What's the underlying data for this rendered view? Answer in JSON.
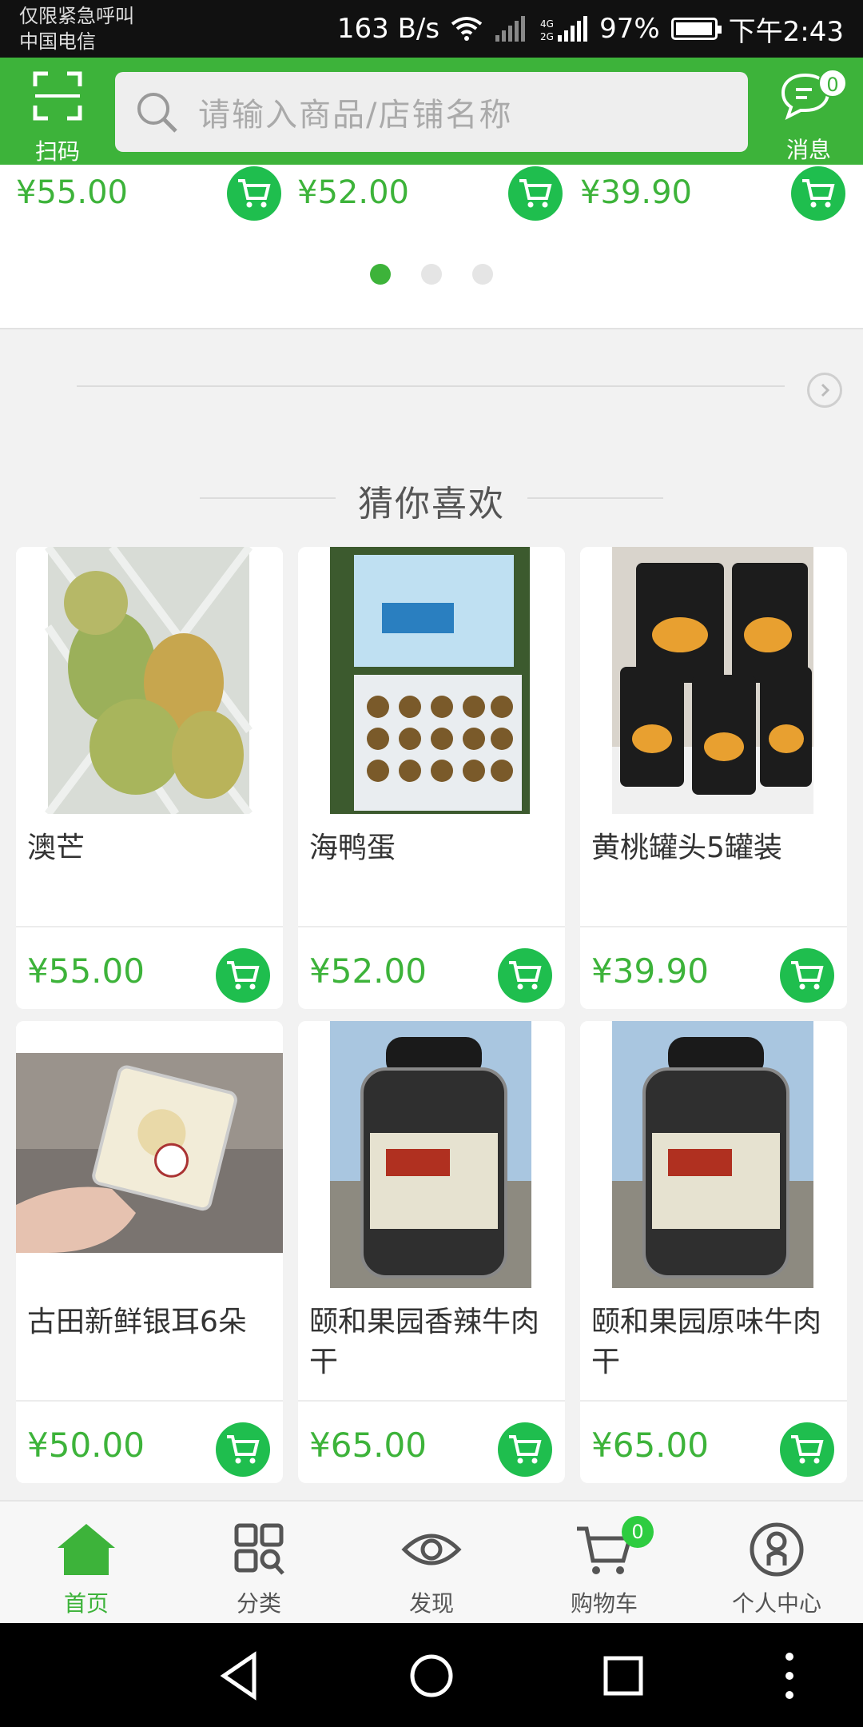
{
  "status_bar": {
    "carrier_line1": "仅限紧急呼叫",
    "carrier_line2": "中国电信",
    "net_speed": "163 B/s",
    "battery": "97%",
    "time": "下午2:43"
  },
  "header": {
    "scan_label": "扫码",
    "search_placeholder": "请输入商品/店铺名称",
    "message_label": "消息",
    "message_count": "0"
  },
  "carousel": {
    "prices": [
      "¥55.00",
      "¥52.00",
      "¥39.90"
    ],
    "page_count": 3,
    "active_page": 1
  },
  "section_title": "猜你喜欢",
  "products": [
    {
      "name": "澳芒",
      "price": "¥55.00"
    },
    {
      "name": "海鸭蛋",
      "price": "¥52.00"
    },
    {
      "name": "黄桃罐头5罐装",
      "price": "¥39.90"
    },
    {
      "name": "古田新鲜银耳6朵",
      "price": "¥50.00"
    },
    {
      "name": "颐和果园香辣牛肉干",
      "price": "¥65.00"
    },
    {
      "name": "颐和果园原味牛肉干",
      "price": "¥65.00"
    }
  ],
  "bottom_nav": {
    "items": [
      {
        "label": "首页",
        "icon": "home-icon"
      },
      {
        "label": "分类",
        "icon": "category-icon"
      },
      {
        "label": "发现",
        "icon": "eye-icon"
      },
      {
        "label": "购物车",
        "icon": "cart-icon"
      },
      {
        "label": "个人中心",
        "icon": "user-icon"
      }
    ],
    "cart_count": "0",
    "active_index": 0
  },
  "colors": {
    "brand_green": "#3db33a",
    "cart_green": "#1fbe4e"
  }
}
